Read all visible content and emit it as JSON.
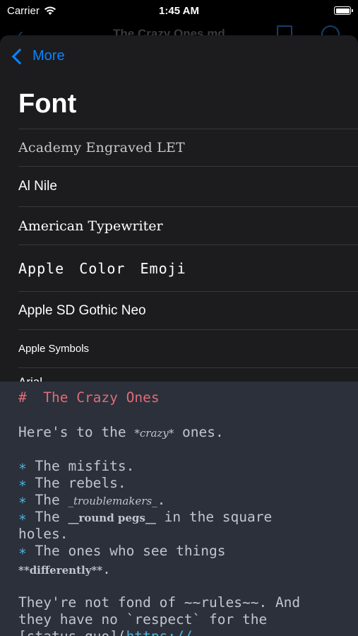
{
  "status_bar": {
    "carrier": "Carrier",
    "time": "1:45 AM"
  },
  "behind_nav": {
    "title": "The Crazy Ones.md"
  },
  "sheet": {
    "back_label": "More",
    "title": "Font",
    "fonts": [
      "Academy Engraved LET",
      "Al Nile",
      "American Typewriter",
      "Apple Color Emoji",
      "Apple SD Gothic Neo",
      "Apple Symbols",
      "Arial"
    ]
  },
  "editor": {
    "heading_mark": "#",
    "heading_text": "The Crazy Ones",
    "l2a": "Here's to the ",
    "l2b": "*crazy*",
    "l2c": " ones.",
    "bullet": "∗",
    "b1": "The misfits.",
    "b2": "The rebels.",
    "b3a": "The ",
    "b3b": "_troublemakers_",
    "b3c": ".",
    "b4a": "The ",
    "b4b": "__round pegs__",
    "b4c": " in the square",
    "b4d": "holes.",
    "b5": "The ones who see things",
    "b5b": "**differently**",
    "b5c": ".",
    "p1": "They're not fond of ~~rules~~. And",
    "p2": "they have no `respect` for the",
    "p3a": "[status quo](",
    "p3b": "https://"
  }
}
